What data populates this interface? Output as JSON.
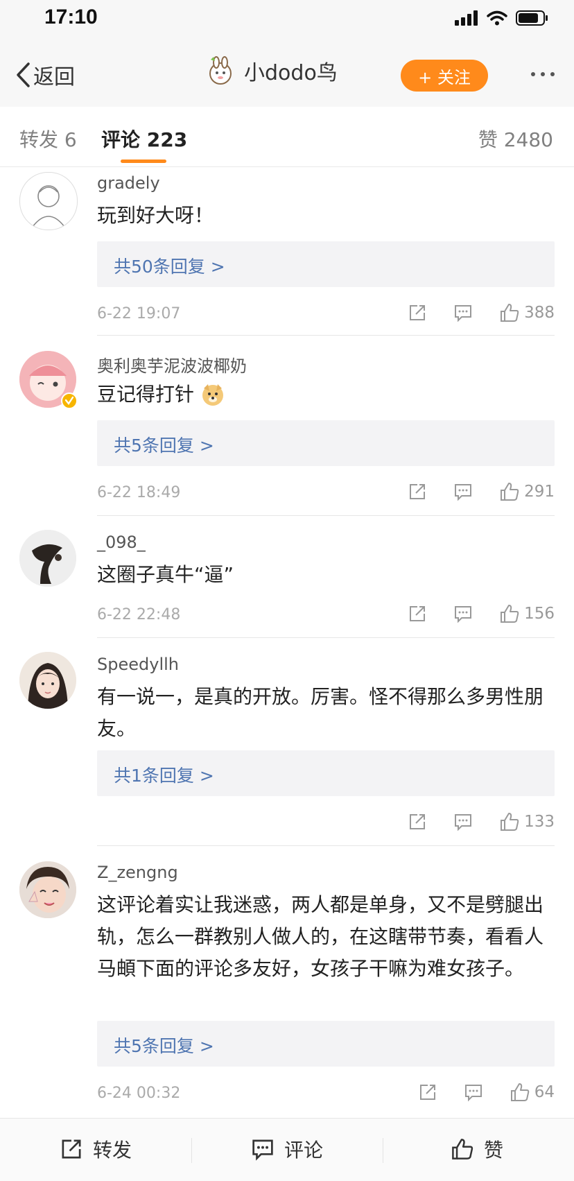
{
  "status_bar": {
    "time": "17:10"
  },
  "nav": {
    "back_label": "返回",
    "user_name": "小dodo鸟",
    "follow_label": "+ 关注"
  },
  "tabs": [
    {
      "label": "转发 6"
    },
    {
      "label": "评论 223"
    },
    {
      "label": "赞 2480"
    }
  ],
  "comments": [
    {
      "user": "gradely",
      "text": "玩到好大呀！",
      "reply": "共50条回复 >",
      "time": "6-22 19:07",
      "likes": "388"
    },
    {
      "user": "奥利奥芋泥波波椰奶",
      "text": "豆记得打针",
      "reply": "共5条回复 >",
      "time": "6-22 18:49",
      "likes": "291"
    },
    {
      "user": "_098_",
      "text": "这圈子真牛“逼”",
      "time": "6-22 22:48",
      "likes": "156"
    },
    {
      "user": "Speedyllh",
      "text": "有一说一，是真的开放。厉害。怪不得那么多男性朋友。",
      "reply": "共1条回复 >",
      "likes": "133"
    },
    {
      "user": "Z_zengng",
      "text": "这评论着实让我迷惑，两人都是单身，又不是劈腿出轨，怎么一群教别人做人的，在这瞎带节奏，看看人马頔下面的评论多友好，女孩子干嘛为难女孩子。",
      "reply": "共5条回复 >",
      "time": "6-24 00:32",
      "likes": "64"
    }
  ],
  "bottom_bar": {
    "repost": "转发",
    "comment": "评论",
    "like": "赞"
  },
  "colors": {
    "accent": "#ff8a1b",
    "link": "#4f75b1"
  },
  "icons": [
    "back-chevron-icon",
    "repost-icon",
    "comment-icon",
    "like-thumb-icon",
    "verified-badge-icon",
    "doge-emoji-icon"
  ]
}
